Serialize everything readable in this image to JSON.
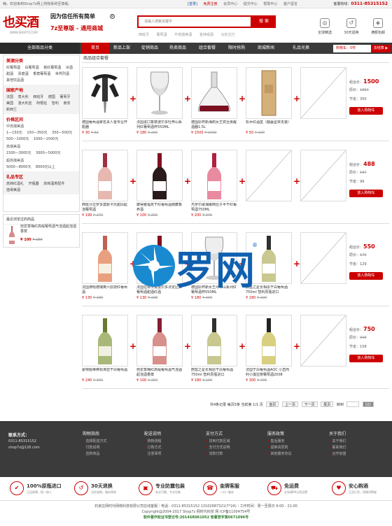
{
  "topbar": {
    "welcome": "嗨，欢迎来到Shop7z网上购物系统至尊版。",
    "links": [
      "[登录]",
      "免费注册",
      "会员中心",
      "提交中心",
      "帮助中心",
      "客户留言"
    ],
    "hotline_label": "客服热线：",
    "hotline": "0311-85315152"
  },
  "header": {
    "logo_text": "也买酒",
    "logo_url": "WWW.SHOP7Z.COM",
    "slogan1": "因为信任所有简单",
    "slogan2": "7z至尊版 - 通用商城",
    "search_placeholder": "请输入搜索关键字",
    "search_button": "搜 索",
    "hot_words": [
      "西班牙",
      "葡萄酒",
      "中低端美酒",
      "金钟威酒",
      "马奶主打"
    ],
    "services": [
      {
        "icon": "globe-icon",
        "glyph": "◎",
        "label": "全球精选"
      },
      {
        "icon": "return-icon",
        "glyph": "↺",
        "label": "30天退换"
      },
      {
        "icon": "shield-icon",
        "glyph": "◈",
        "label": "满额包邮"
      }
    ]
  },
  "nav": {
    "category_label": "全部商品分类",
    "items": [
      "首页",
      "新品上架",
      "促销商品",
      "热卖商品",
      "组合套餐",
      "限时抢购",
      "商城新闻",
      "礼品兑换"
    ],
    "active_index": 0,
    "cart_label": "购物车：0件",
    "cart_button": "去结算 ▶"
  },
  "sidebar": {
    "sections": [
      {
        "title": "美酒分类",
        "links": [
          "红葡萄酒",
          "白葡萄酒",
          "桃红葡萄酒",
          "冰酒",
          "甜酒",
          "贵腐酒",
          "香槟葡萄酒",
          "世界烈酒",
          "其他饮品酒"
        ]
      },
      {
        "title": "国家产地",
        "links": [
          "法国",
          "意大利",
          "西班牙",
          "德国",
          "葡萄牙",
          "美国",
          "澳大利亚",
          "阿根廷",
          "智利",
          "南非",
          "新西兰"
        ]
      },
      {
        "title": "价格区间",
        "groups": [
          {
            "sub": "中低端美酒",
            "links": [
              "1—150元",
              "150—350元",
              "350—500元",
              "500—1000元",
              "1000—1500元"
            ]
          },
          {
            "sub": "高端美酒",
            "links": [
              "1500—3000元",
              "3000—5000元"
            ]
          },
          {
            "sub": "超高端美酒",
            "links": [
              "5000—8000元",
              "8000元以上"
            ]
          }
        ]
      },
      {
        "title": "礼品专区",
        "links": [
          "高档红酒礼",
          "开瓶器",
          "高档酒类配件",
          "值得美酒"
        ]
      }
    ]
  },
  "recent": {
    "title": "最近浏览过的商品",
    "name": "芭爱季梅红高缇葡萄酒气泡酒起泡酒香槟",
    "price": "¥ 100",
    "old_price": "¥ 150"
  },
  "main": {
    "title": "商品组合套餐",
    "combos": [
      {
        "products": [
          {
            "name": "德国葡萄酒家名贵人金专业开瓶器",
            "price": "¥ 30",
            "old": "¥ 32",
            "img": "opener"
          },
          {
            "name": "法国进口香槟波尔多吐奔山系列红葡萄酒杯550ML",
            "price": "¥ 180",
            "old": "¥ 200",
            "img": "glass"
          },
          {
            "name": "德国原杯斯海莉女王宾至惠醒酒器1.5L",
            "price": "¥ 1500",
            "old": "¥ 2000",
            "img": "decanter"
          },
          {
            "name": "松木红酒盒（翻盖型单支装）",
            "price": "¥ 50",
            "old": "¥ 100",
            "img": "box"
          },
          {
            "name": "",
            "price": "",
            "old": "",
            "img": "empty"
          }
        ],
        "total": "1500",
        "original": "1850",
        "save": "350"
      },
      {
        "products": [
          {
            "name": "西班牙拉罗多莫斯卡托甜白起泡葡萄酒",
            "price": "¥ 199",
            "old": "¥ 270",
            "img": "pink"
          },
          {
            "name": "康得雅福克干红葡萄酒典藏香养酒",
            "price": "¥ 100",
            "old": "¥ 200",
            "img": "red"
          },
          {
            "name": "杰罗尔歌海娜西拉子半干红葡萄酒750ML",
            "price": "¥ 200",
            "old": "¥ 345",
            "img": "rose"
          },
          {
            "name": "",
            "price": "",
            "old": "",
            "img": "empty"
          },
          {
            "name": "",
            "price": "",
            "old": "",
            "img": "empty"
          }
        ],
        "total": "488",
        "original": "587",
        "save": "99"
      },
      {
        "products": [
          {
            "name": "法国滴哈德瑞奥六层烧红葡萄酒",
            "price": "¥ 130",
            "old": "¥ 180",
            "img": "six"
          },
          {
            "name": "法国拉菲传说波尔多法定区红葡萄酒甜酒红酒",
            "price": "¥ 130",
            "old": "¥ 198",
            "img": "red"
          },
          {
            "name": "德国原杯斯女王丹华山系列红葡萄酒杯550ML",
            "price": "¥ 180",
            "old": "¥ 200",
            "img": "glass"
          },
          {
            "name": "蔚蓝之星长相思干白葡萄酒750ml 智利原瓶进口",
            "price": "¥ 180",
            "old": "¥ 199",
            "img": "white"
          },
          {
            "name": "",
            "price": "",
            "old": "",
            "img": "empty"
          }
        ],
        "total": "550",
        "original": "679",
        "save": "129"
      },
      {
        "products": [
          {
            "name": "蒙特姬维弗标准亚干白葡萄酒",
            "price": "¥ 240",
            "old": "¥ 300",
            "img": "green"
          },
          {
            "name": "芭爱季梅红高缇葡萄酒气泡酒起泡酒香槟",
            "price": "¥ 100",
            "old": "¥ 150",
            "img": "sparkle"
          },
          {
            "name": "蔚蓝之星长相思干白葡萄酒750ml 智利原瓶进口",
            "price": "¥ 180",
            "old": "¥ 199",
            "img": "white"
          },
          {
            "name": "法国于白葡萄酒AOC 小直布利小莲拉丽葡萄酒2008",
            "price": "¥ 300",
            "old": "¥ 400",
            "img": "yellow"
          },
          {
            "name": "",
            "price": "",
            "old": "",
            "img": "empty"
          }
        ],
        "total": "750",
        "original": "908",
        "save": "158"
      }
    ],
    "labels": {
      "total": "组合价：",
      "original": "原价：",
      "save": "节省：",
      "buy": "放入购物车"
    },
    "pager": {
      "info": "共4条记录 每页5条 当前第 1/1 页",
      "buttons": [
        "首页",
        "上一页",
        "下一页",
        "尾页"
      ],
      "jump_label": "转到",
      "go": "GO"
    }
  },
  "footer": {
    "contact_title": "联系方式：",
    "phone": "0311-85315152",
    "email": "shop7z@126.com",
    "columns": [
      {
        "title": "购物指南",
        "items": [
          "选择配送方式",
          "付款说明",
          "选购商品"
        ]
      },
      {
        "title": "配送说明",
        "items": [
          "购物流程",
          "订购方式",
          "注意事项"
        ]
      },
      {
        "title": "支付方式",
        "items": [
          "货到付款区域",
          "支付方式说明",
          "货款付款"
        ]
      },
      {
        "title": "服务政策",
        "items": [
          "售后服务",
          "退换货原则",
          "其他服务协议"
        ]
      },
      {
        "title": "关于我们",
        "items": [
          "关于我们",
          "联系我们",
          "合作加盟"
        ]
      }
    ]
  },
  "guarantees": [
    {
      "icon": "badge-icon",
      "glyph": "✔",
      "title": "100%原瓶进口",
      "sub": "正品保障，假一赔十"
    },
    {
      "icon": "return-icon",
      "glyph": "↺",
      "title": "30天退换",
      "sub": "无忧退换，服务周到"
    },
    {
      "icon": "package-icon",
      "glyph": "▣",
      "title": "专业防震包装",
      "sub": "安全可靠，专业包装"
    },
    {
      "icon": "headset-icon",
      "glyph": "☎",
      "title": "金牌客服",
      "sub": "一对一服务"
    },
    {
      "icon": "truck-icon",
      "glyph": "⛟",
      "title": "免运费",
      "sub": "全场满99元免运费"
    },
    {
      "icon": "heart-icon",
      "glyph": "♥",
      "title": "安心购酒",
      "sub": "正品行货，保障消费者"
    }
  ],
  "copyright": {
    "line1": "石家庄网时代网络科技有限公司在线客服｜电话：0311-85315152 13102687321(7*24)｜工作时间：周一至周日 9:00 - 21:00",
    "line2": "Copyright@2004-2017 Shop7z 网时代科技 网 ICP备11004754号",
    "line3": "软件著作权证书登记号:2014SR061052 软著登字第0671096号"
  },
  "watermark": {
    "text": "罗网",
    "reg": "®"
  }
}
